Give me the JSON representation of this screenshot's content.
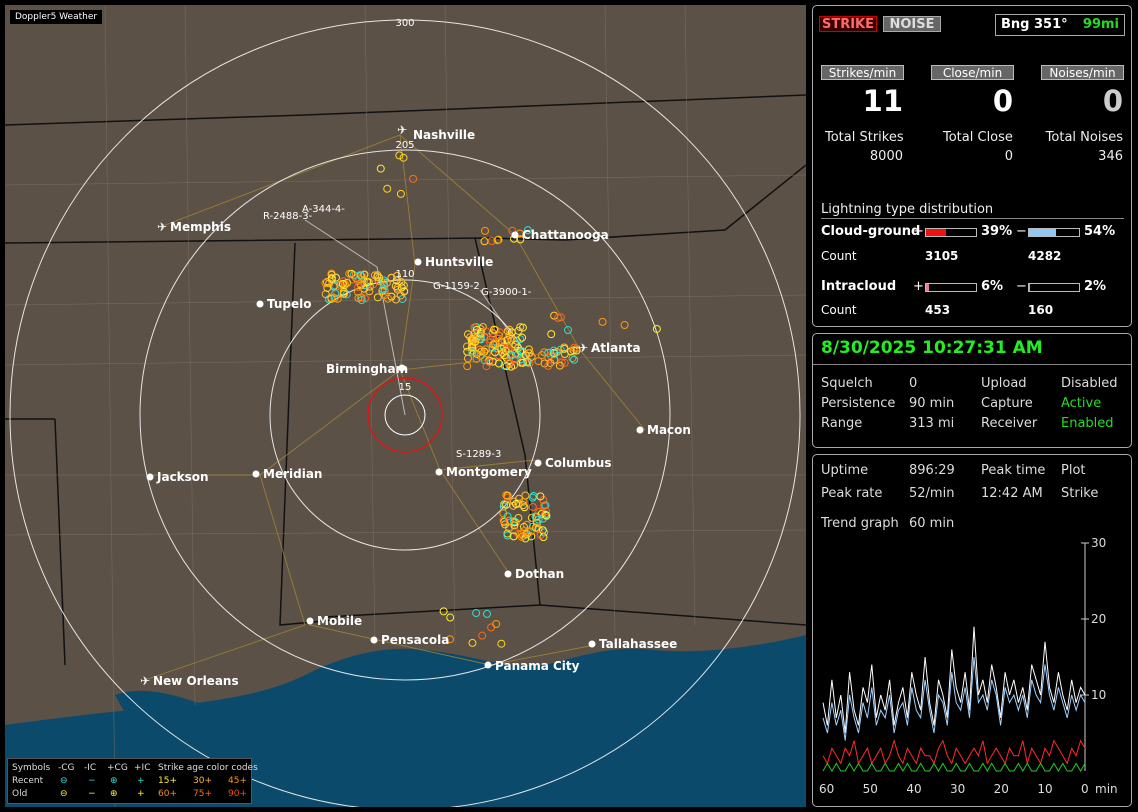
{
  "map": {
    "tag": "Doppler5 Weather",
    "range_rings": [
      "300",
      "205",
      "110",
      "15"
    ],
    "cities": [
      "Nashville",
      "Memphis",
      "Chattanooga",
      "Huntsville",
      "Tupelo",
      "Birmingham",
      "Atlanta",
      "Macon",
      "Jackson",
      "Meridian",
      "Montgomery",
      "Columbus",
      "Dothan",
      "Mobile",
      "Pensacola",
      "Tallahassee",
      "Panama City",
      "New Orleans"
    ],
    "tracks": [
      "A-344-4-",
      "R-2488-3-",
      "G-1159-2",
      "G-3900-1-",
      "S-1289-3"
    ]
  },
  "legend": {
    "row1": {
      "symbols": "Symbols",
      "cg_neg": "-CG",
      "ic_neg": "-IC",
      "cg_pos": "+CG",
      "ic_pos": "+IC",
      "age_title": "Strike age color codes"
    },
    "row2": {
      "label": "Recent",
      "a": "15+",
      "b": "30+",
      "c": "45+"
    },
    "row3": {
      "label": "Old",
      "a": "60+",
      "b": "75+",
      "c": "90+"
    }
  },
  "header": {
    "strike_button": "STRIKE",
    "noise_button": "NOISE",
    "bearing": "Bng 351°",
    "distance": "99mi"
  },
  "rates": {
    "strikes_label": "Strikes/min",
    "close_label": "Close/min",
    "noises_label": "Noises/min",
    "strikes_value": "11",
    "close_value": "0",
    "noises_value": "0"
  },
  "totals": {
    "strikes_label": "Total Strikes",
    "close_label": "Total Close",
    "noises_label": "Total Noises",
    "strikes": "8000",
    "close": "0",
    "noises": "346"
  },
  "distribution": {
    "title": "Lightning type distribution",
    "cloud_ground_label": "Cloud-ground",
    "intracloud_label": "Intracloud",
    "count_label": "Count",
    "plus": "+",
    "minus": "−",
    "cg_pos_pct": "39%",
    "cg_neg_pct": "54%",
    "cg_pos_count": "3105",
    "cg_neg_count": "4282",
    "ic_pos_pct": "6%",
    "ic_neg_pct": "2%",
    "ic_pos_count": "453",
    "ic_neg_count": "160",
    "cg_pos_fraction": 0.39,
    "cg_neg_fraction": 0.54,
    "ic_pos_fraction": 0.06,
    "ic_neg_fraction": 0.02
  },
  "status": {
    "datetime": "8/30/2025 10:27:31 AM",
    "squelch_label": "Squelch",
    "squelch": "0",
    "persistence_label": "Persistence",
    "persistence": "90 min",
    "range_label": "Range",
    "range": "313 mi",
    "upload_label": "Upload",
    "upload": "Disabled",
    "capture_label": "Capture",
    "capture": "Active",
    "receiver_label": "Receiver",
    "receiver": "Enabled"
  },
  "stats": {
    "uptime_label": "Uptime",
    "uptime": "896:29",
    "peak_time_label": "Peak time",
    "peak_time": "12:42 AM",
    "plot_label": "Plot",
    "plot": "Strike",
    "peak_rate_label": "Peak rate",
    "peak_rate": "52/min",
    "trend_label": "Trend graph",
    "trend": "60 min"
  },
  "chart_data": {
    "type": "line",
    "x_tick_labels": [
      "60",
      "50",
      "40",
      "30",
      "20",
      "10",
      "0"
    ],
    "x_unit": "min",
    "y_tick_labels": [
      "10",
      "20",
      "30"
    ],
    "ylim": [
      0,
      30
    ],
    "xlim": [
      60,
      0
    ],
    "series": [
      {
        "color": "#ffffff",
        "values": [
          9,
          6,
          12,
          7,
          10,
          5,
          13,
          8,
          6,
          11,
          9,
          14,
          7,
          10,
          8,
          12,
          6,
          9,
          11,
          7,
          13,
          10,
          8,
          15,
          9,
          6,
          12,
          10,
          7,
          16,
          11,
          9,
          13,
          8,
          19,
          10,
          12,
          9,
          14,
          11,
          7,
          13,
          10,
          12,
          9,
          11,
          8,
          14,
          12,
          10,
          17,
          11,
          9,
          13,
          10,
          8,
          12,
          9,
          11,
          10
        ]
      },
      {
        "color": "#9fd0ff",
        "values": [
          7,
          5,
          9,
          6,
          8,
          4,
          10,
          7,
          5,
          9,
          7,
          11,
          6,
          8,
          7,
          10,
          5,
          8,
          9,
          6,
          11,
          8,
          7,
          12,
          8,
          5,
          10,
          9,
          6,
          13,
          9,
          8,
          11,
          7,
          15,
          9,
          10,
          8,
          12,
          10,
          6,
          11,
          9,
          10,
          8,
          10,
          7,
          12,
          10,
          9,
          14,
          10,
          8,
          11,
          9,
          7,
          10,
          8,
          10,
          9
        ]
      },
      {
        "color": "#ff2a2a",
        "values": [
          2,
          1,
          3,
          2,
          1,
          3,
          2,
          4,
          1,
          2,
          3,
          1,
          2,
          3,
          1,
          2,
          4,
          2,
          1,
          3,
          2,
          1,
          3,
          2,
          2,
          1,
          3,
          4,
          2,
          1,
          3,
          2,
          1,
          2,
          3,
          2,
          4,
          1,
          2,
          3,
          2,
          1,
          3,
          2,
          2,
          4,
          1,
          3,
          2,
          1,
          3,
          2,
          4,
          3,
          2,
          1,
          3,
          2,
          4,
          3
        ]
      },
      {
        "color": "#22cc22",
        "values": [
          0,
          1,
          0,
          1,
          0,
          0,
          1,
          0,
          1,
          0,
          0,
          1,
          0,
          0,
          1,
          0,
          0,
          1,
          0,
          1,
          0,
          0,
          1,
          0,
          0,
          1,
          0,
          1,
          0,
          0,
          1,
          0,
          0,
          1,
          0,
          0,
          1,
          0,
          1,
          0,
          0,
          1,
          0,
          0,
          1,
          0,
          1,
          0,
          0,
          1,
          0,
          0,
          1,
          0,
          1,
          0,
          0,
          1,
          0,
          1
        ]
      }
    ]
  }
}
